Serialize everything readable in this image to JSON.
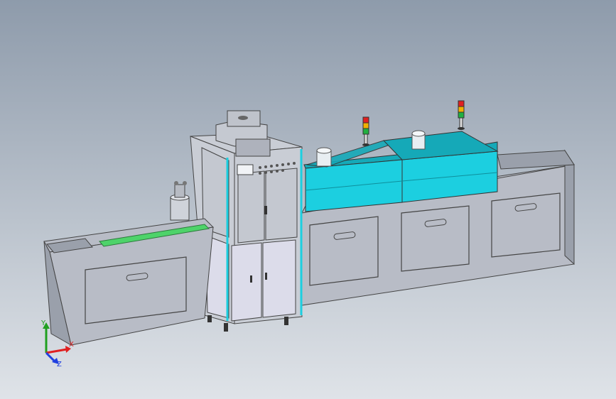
{
  "viewport": {
    "background_top": "#8e9bab",
    "background_bottom": "#dfe3e8"
  },
  "model": {
    "panel_color": "#b8bcc6",
    "panel_dark": "#9aa0ab",
    "cover_color": "#1ccfe0",
    "cover_dark": "#15a9b8",
    "frame_color": "#c9cdd5",
    "door_color": "#dcdcea",
    "accent_green": "#4ed36a",
    "signal_tower_colors": [
      "#e02020",
      "#f0b000",
      "#20b040"
    ]
  },
  "triad": {
    "x_label": "X",
    "y_label": "Y",
    "z_label": "Z",
    "x_color": "#e02020",
    "y_color": "#20a020",
    "z_color": "#2040e0"
  }
}
